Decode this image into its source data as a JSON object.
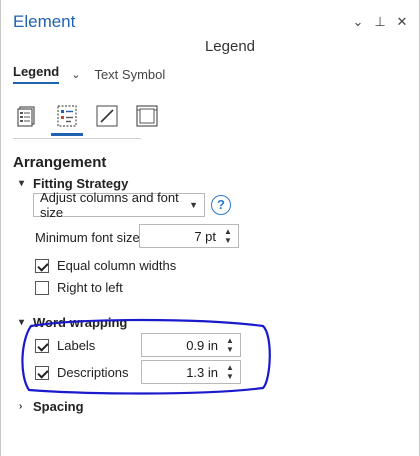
{
  "window": {
    "title": "Element",
    "controls": {
      "menu": "⌄",
      "pin": "⊥",
      "close": "✕"
    }
  },
  "subtitle": "Legend",
  "tabs": {
    "active": "Legend",
    "chevron": "⌄",
    "other": "Text Symbol"
  },
  "toolbar_icons": [
    "legend-options-icon",
    "legend-arrangement-icon",
    "pen-symbol-icon",
    "display-frame-icon"
  ],
  "arrangement": {
    "heading": "Arrangement",
    "fitting_strategy": {
      "heading": "Fitting Strategy",
      "dropdown_value": "Adjust columns and font size",
      "help": "?",
      "min_font_label": "Minimum font size",
      "min_font_value": "7 pt",
      "equal_columns_label": "Equal column widths",
      "equal_columns_checked": true,
      "rtl_label": "Right to left",
      "rtl_checked": false
    },
    "word_wrapping": {
      "heading": "Word wrapping",
      "labels_label": "Labels",
      "labels_checked": true,
      "labels_value": "0.9 in",
      "descriptions_label": "Descriptions",
      "descriptions_checked": true,
      "descriptions_value": "1.3 in"
    },
    "spacing": {
      "heading": "Spacing"
    }
  },
  "colors": {
    "accent": "#1f63b0",
    "annotation": "#1a1acc"
  }
}
